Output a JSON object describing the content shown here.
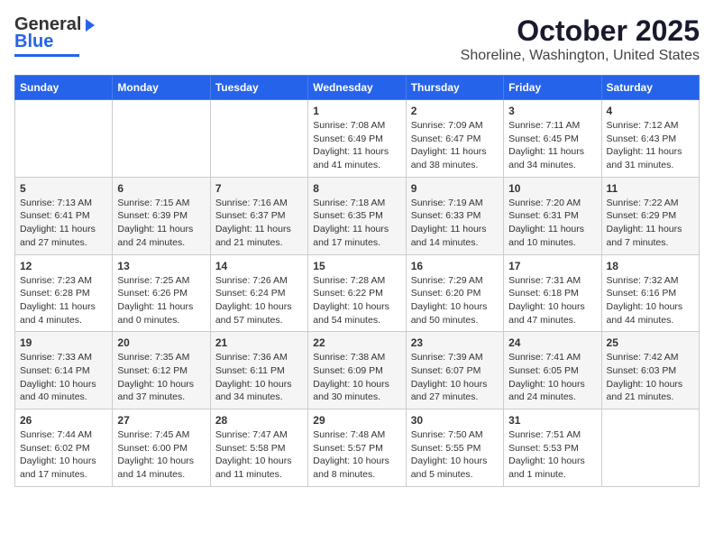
{
  "header": {
    "logo_general": "General",
    "logo_blue": "Blue",
    "title": "October 2025",
    "subtitle": "Shoreline, Washington, United States"
  },
  "weekdays": [
    "Sunday",
    "Monday",
    "Tuesday",
    "Wednesday",
    "Thursday",
    "Friday",
    "Saturday"
  ],
  "weeks": [
    [
      {
        "day": "",
        "info": ""
      },
      {
        "day": "",
        "info": ""
      },
      {
        "day": "",
        "info": ""
      },
      {
        "day": "1",
        "info": "Sunrise: 7:08 AM\nSunset: 6:49 PM\nDaylight: 11 hours\nand 41 minutes."
      },
      {
        "day": "2",
        "info": "Sunrise: 7:09 AM\nSunset: 6:47 PM\nDaylight: 11 hours\nand 38 minutes."
      },
      {
        "day": "3",
        "info": "Sunrise: 7:11 AM\nSunset: 6:45 PM\nDaylight: 11 hours\nand 34 minutes."
      },
      {
        "day": "4",
        "info": "Sunrise: 7:12 AM\nSunset: 6:43 PM\nDaylight: 11 hours\nand 31 minutes."
      }
    ],
    [
      {
        "day": "5",
        "info": "Sunrise: 7:13 AM\nSunset: 6:41 PM\nDaylight: 11 hours\nand 27 minutes."
      },
      {
        "day": "6",
        "info": "Sunrise: 7:15 AM\nSunset: 6:39 PM\nDaylight: 11 hours\nand 24 minutes."
      },
      {
        "day": "7",
        "info": "Sunrise: 7:16 AM\nSunset: 6:37 PM\nDaylight: 11 hours\nand 21 minutes."
      },
      {
        "day": "8",
        "info": "Sunrise: 7:18 AM\nSunset: 6:35 PM\nDaylight: 11 hours\nand 17 minutes."
      },
      {
        "day": "9",
        "info": "Sunrise: 7:19 AM\nSunset: 6:33 PM\nDaylight: 11 hours\nand 14 minutes."
      },
      {
        "day": "10",
        "info": "Sunrise: 7:20 AM\nSunset: 6:31 PM\nDaylight: 11 hours\nand 10 minutes."
      },
      {
        "day": "11",
        "info": "Sunrise: 7:22 AM\nSunset: 6:29 PM\nDaylight: 11 hours\nand 7 minutes."
      }
    ],
    [
      {
        "day": "12",
        "info": "Sunrise: 7:23 AM\nSunset: 6:28 PM\nDaylight: 11 hours\nand 4 minutes."
      },
      {
        "day": "13",
        "info": "Sunrise: 7:25 AM\nSunset: 6:26 PM\nDaylight: 11 hours\nand 0 minutes."
      },
      {
        "day": "14",
        "info": "Sunrise: 7:26 AM\nSunset: 6:24 PM\nDaylight: 10 hours\nand 57 minutes."
      },
      {
        "day": "15",
        "info": "Sunrise: 7:28 AM\nSunset: 6:22 PM\nDaylight: 10 hours\nand 54 minutes."
      },
      {
        "day": "16",
        "info": "Sunrise: 7:29 AM\nSunset: 6:20 PM\nDaylight: 10 hours\nand 50 minutes."
      },
      {
        "day": "17",
        "info": "Sunrise: 7:31 AM\nSunset: 6:18 PM\nDaylight: 10 hours\nand 47 minutes."
      },
      {
        "day": "18",
        "info": "Sunrise: 7:32 AM\nSunset: 6:16 PM\nDaylight: 10 hours\nand 44 minutes."
      }
    ],
    [
      {
        "day": "19",
        "info": "Sunrise: 7:33 AM\nSunset: 6:14 PM\nDaylight: 10 hours\nand 40 minutes."
      },
      {
        "day": "20",
        "info": "Sunrise: 7:35 AM\nSunset: 6:12 PM\nDaylight: 10 hours\nand 37 minutes."
      },
      {
        "day": "21",
        "info": "Sunrise: 7:36 AM\nSunset: 6:11 PM\nDaylight: 10 hours\nand 34 minutes."
      },
      {
        "day": "22",
        "info": "Sunrise: 7:38 AM\nSunset: 6:09 PM\nDaylight: 10 hours\nand 30 minutes."
      },
      {
        "day": "23",
        "info": "Sunrise: 7:39 AM\nSunset: 6:07 PM\nDaylight: 10 hours\nand 27 minutes."
      },
      {
        "day": "24",
        "info": "Sunrise: 7:41 AM\nSunset: 6:05 PM\nDaylight: 10 hours\nand 24 minutes."
      },
      {
        "day": "25",
        "info": "Sunrise: 7:42 AM\nSunset: 6:03 PM\nDaylight: 10 hours\nand 21 minutes."
      }
    ],
    [
      {
        "day": "26",
        "info": "Sunrise: 7:44 AM\nSunset: 6:02 PM\nDaylight: 10 hours\nand 17 minutes."
      },
      {
        "day": "27",
        "info": "Sunrise: 7:45 AM\nSunset: 6:00 PM\nDaylight: 10 hours\nand 14 minutes."
      },
      {
        "day": "28",
        "info": "Sunrise: 7:47 AM\nSunset: 5:58 PM\nDaylight: 10 hours\nand 11 minutes."
      },
      {
        "day": "29",
        "info": "Sunrise: 7:48 AM\nSunset: 5:57 PM\nDaylight: 10 hours\nand 8 minutes."
      },
      {
        "day": "30",
        "info": "Sunrise: 7:50 AM\nSunset: 5:55 PM\nDaylight: 10 hours\nand 5 minutes."
      },
      {
        "day": "31",
        "info": "Sunrise: 7:51 AM\nSunset: 5:53 PM\nDaylight: 10 hours\nand 1 minute."
      },
      {
        "day": "",
        "info": ""
      }
    ]
  ]
}
